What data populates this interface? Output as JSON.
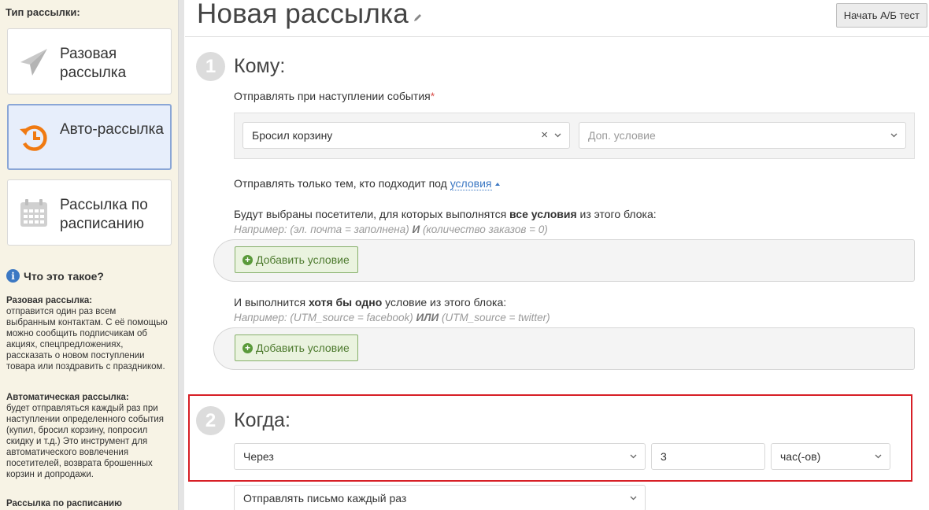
{
  "sidebar": {
    "title": "Тип рассылки:",
    "types": [
      {
        "label": "Разовая рассылка",
        "icon": "paper-plane-icon"
      },
      {
        "label": "Авто-рассылка",
        "icon": "auto-clock-icon"
      },
      {
        "label": "Рассылка по расписанию",
        "icon": "calendar-icon"
      }
    ],
    "info_title": "Что это такое?",
    "info": [
      {
        "title": "Разовая рассылка:",
        "text": "отправится один раз всем выбранным контактам. С её помощью можно сообщить подписчикам об акциях, спецпредложениях, рассказать о новом поступлении товара или поздравить с праздником."
      },
      {
        "title": "Автоматическая рассылка:",
        "text": "будет отправляться каждый раз при наступлении определенного события (купил, бросил корзину, попросил скидку и т.д.) Это инструмент для автоматического вовлечения посетителей, возврата брошенных корзин и допродажи."
      },
      {
        "title": "Рассылка по расписанию",
        "text": ""
      }
    ]
  },
  "header": {
    "title": "Новая рассылка",
    "ab_test_label": "Начать А/Б тест"
  },
  "step1": {
    "number": "1",
    "title": "Кому:",
    "event_label": "Отправлять при наступлении события",
    "required_mark": "*",
    "event_value": "Бросил корзину",
    "extra_condition_placeholder": "Доп. условие",
    "only_to_prefix": "Отправлять только тем, кто подходит под",
    "only_to_link": "условия",
    "all_block": {
      "pre": "Будут выбраны посетители, для которых выполнятся",
      "bold": "все условия",
      "post": "из этого блока:",
      "hint_pre": "Например: (эл. почта = заполнена)",
      "hint_op": "И",
      "hint_post": "(количество заказов = 0)",
      "add_label": "Добавить условие"
    },
    "any_block": {
      "pre": "И выполнится",
      "bold": "хотя бы одно",
      "post": "условие из этого блока:",
      "hint_pre": "Например: (UTM_source = facebook)",
      "hint_op": "ИЛИ",
      "hint_post": "(UTM_source = twitter)",
      "add_label": "Добавить условие"
    }
  },
  "step2": {
    "number": "2",
    "title": "Когда:",
    "delay_type": "Через",
    "delay_value": "3",
    "delay_unit": "час(-ов)",
    "frequency": "Отправлять письмо каждый раз"
  },
  "colors": {
    "sidebar_bg": "#f7f3e5",
    "active_card_bg": "#e7eefb",
    "link": "#3c78c3",
    "add_button": "#4d7a2e",
    "highlight_border": "#d71f26",
    "auto_icon": "#f07a12"
  }
}
